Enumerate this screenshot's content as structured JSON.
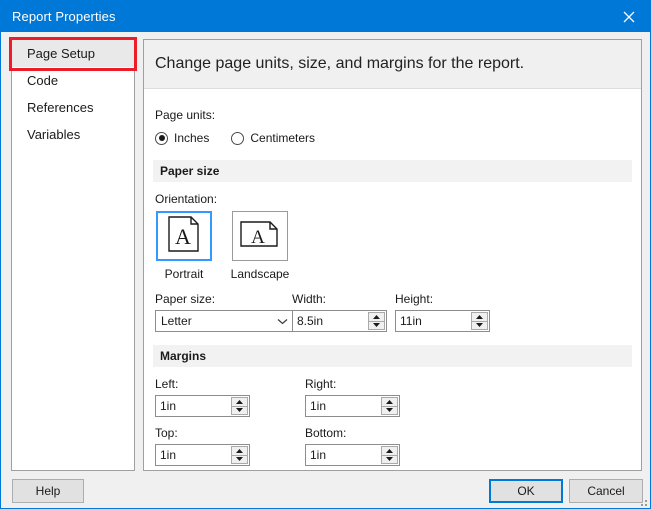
{
  "window": {
    "title": "Report Properties",
    "close_icon": "close-icon",
    "accent_color": "#0078d7",
    "highlight_color": "#ec1c28"
  },
  "sidebar": {
    "items": [
      {
        "label": "Page Setup",
        "selected": true
      },
      {
        "label": "Code",
        "selected": false
      },
      {
        "label": "References",
        "selected": false
      },
      {
        "label": "Variables",
        "selected": false
      }
    ]
  },
  "content": {
    "header_text": "Change page units, size, and margins for the report.",
    "page_units": {
      "label": "Page units:",
      "options": [
        {
          "label": "Inches",
          "checked": true
        },
        {
          "label": "Centimeters",
          "checked": false
        }
      ]
    },
    "paper_size_section": {
      "title": "Paper size",
      "orientation_label": "Orientation:",
      "orientations": [
        {
          "label": "Portrait",
          "selected": true,
          "icon": "page-portrait-icon"
        },
        {
          "label": "Landscape",
          "selected": false,
          "icon": "page-landscape-icon"
        }
      ],
      "paper_size_label": "Paper size:",
      "paper_size_value": "Letter",
      "width_label": "Width:",
      "width_value": "8.5in",
      "height_label": "Height:",
      "height_value": "11in"
    },
    "margins_section": {
      "title": "Margins",
      "left_label": "Left:",
      "left_value": "1in",
      "right_label": "Right:",
      "right_value": "1in",
      "top_label": "Top:",
      "top_value": "1in",
      "bottom_label": "Bottom:",
      "bottom_value": "1in"
    }
  },
  "footer": {
    "help_label": "Help",
    "ok_label": "OK",
    "cancel_label": "Cancel"
  }
}
